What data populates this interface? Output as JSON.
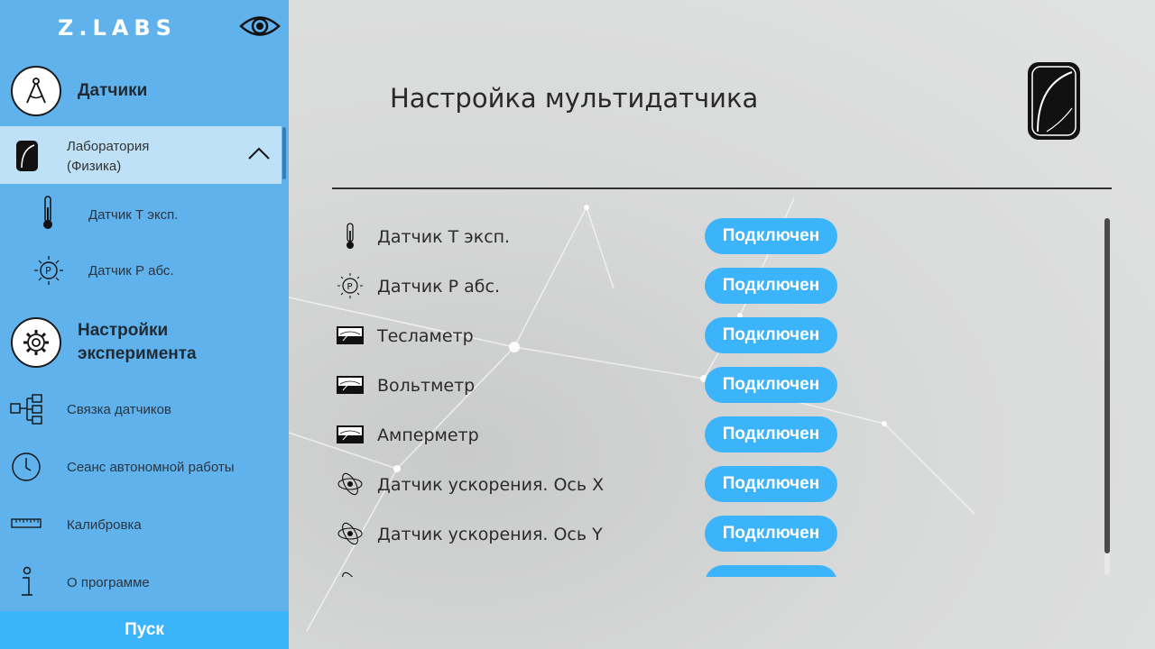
{
  "app": {
    "logo": "Z.LABS"
  },
  "sidebar": {
    "sensors_title": "Датчики",
    "lab_label": "Лаборатория\n(Физика)",
    "lab_line1": "Лаборатория",
    "lab_line2": "(Физика)",
    "sub_items": [
      {
        "label": "Датчик Т эксп.",
        "icon": "thermometer-icon"
      },
      {
        "label": "Датчик Р абс.",
        "icon": "pressure-icon"
      }
    ],
    "experiment_title_1": "Настройки",
    "experiment_title_2": "эксперимента",
    "nav_items": [
      {
        "label": "Связка датчиков",
        "icon": "sensor-link-icon"
      },
      {
        "label": "Сеанс автономной работы",
        "icon": "clock-icon"
      },
      {
        "label": "Калибровка",
        "icon": "ruler-icon"
      },
      {
        "label": "О программе",
        "icon": "info-icon"
      }
    ],
    "start_label": "Пуск"
  },
  "main": {
    "title": "Настройка мультидатчика",
    "sensors": [
      {
        "label": "Датчик Т эксп.",
        "status": "Подключен",
        "icon": "thermometer-icon"
      },
      {
        "label": "Датчик Р абс.",
        "status": "Подключен",
        "icon": "pressure-icon"
      },
      {
        "label": "Тесламетр",
        "status": "Подключен",
        "icon": "meter-icon"
      },
      {
        "label": "Вольтметр",
        "status": "Подключен",
        "icon": "meter-icon"
      },
      {
        "label": "Амперметр",
        "status": "Подключен",
        "icon": "meter-icon"
      },
      {
        "label": "Датчик ускорения. Ось X",
        "status": "Подключен",
        "icon": "acceleration-icon"
      },
      {
        "label": "Датчик ускорения. Ось Y",
        "status": "Подключен",
        "icon": "acceleration-icon"
      },
      {
        "label": "",
        "status": "",
        "icon": "acceleration-icon"
      }
    ]
  },
  "colors": {
    "sidebar": "#5fb2ec",
    "active": "#bfe1f7",
    "accent": "#3cb4fb"
  }
}
